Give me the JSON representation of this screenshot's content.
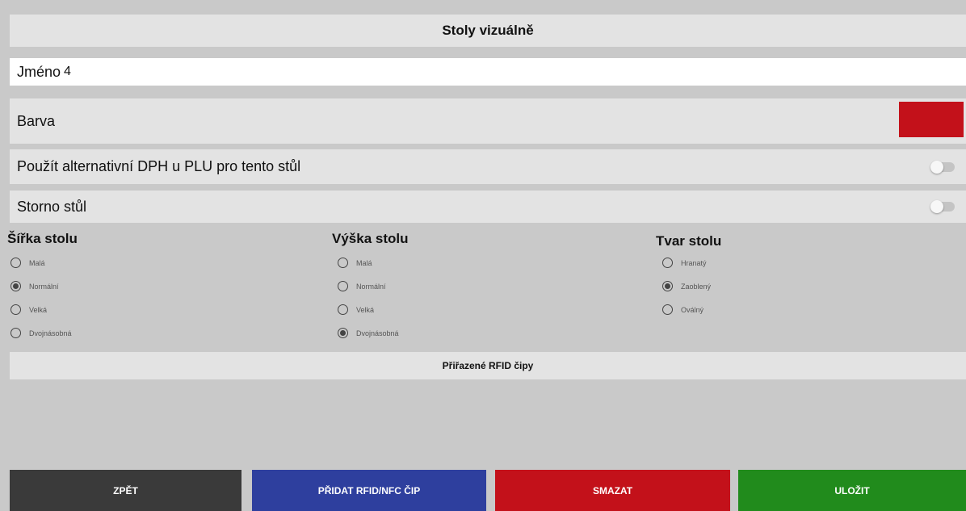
{
  "header": {
    "title": "Stoly vizuálně"
  },
  "name_field": {
    "label": "Jméno",
    "value": "4"
  },
  "color_field": {
    "label": "Barva",
    "color": "#c3111a"
  },
  "alt_vat": {
    "label": "Použít alternativní DPH u PLU pro tento stůl",
    "on": false
  },
  "storno": {
    "label": "Storno stůl",
    "on": false
  },
  "width_group": {
    "title": "Šířka stolu",
    "options": [
      "Malá",
      "Normální",
      "Velká",
      "Dvojnásobná"
    ],
    "selected": "Normální"
  },
  "height_group": {
    "title": "Výška stolu",
    "options": [
      "Malá",
      "Normální",
      "Velká",
      "Dvojnásobná"
    ],
    "selected": "Dvojnásobná"
  },
  "shape_group": {
    "title": "Tvar stolu",
    "options": [
      "Hranatý",
      "Zaoblený",
      "Oválný"
    ],
    "selected": "Zaoblený"
  },
  "rfid": {
    "label": "Přiřazené RFID čipy"
  },
  "buttons": {
    "back": "ZPĚT",
    "add_rfid": "PŘIDAT RFID/NFC ČIP",
    "delete": "SMAZAT",
    "save": "ULOŽIT"
  },
  "colors": {
    "back": "#3a3a3a",
    "add_rfid": "#2e3f9e",
    "delete": "#c3111a",
    "save": "#218b1c"
  }
}
